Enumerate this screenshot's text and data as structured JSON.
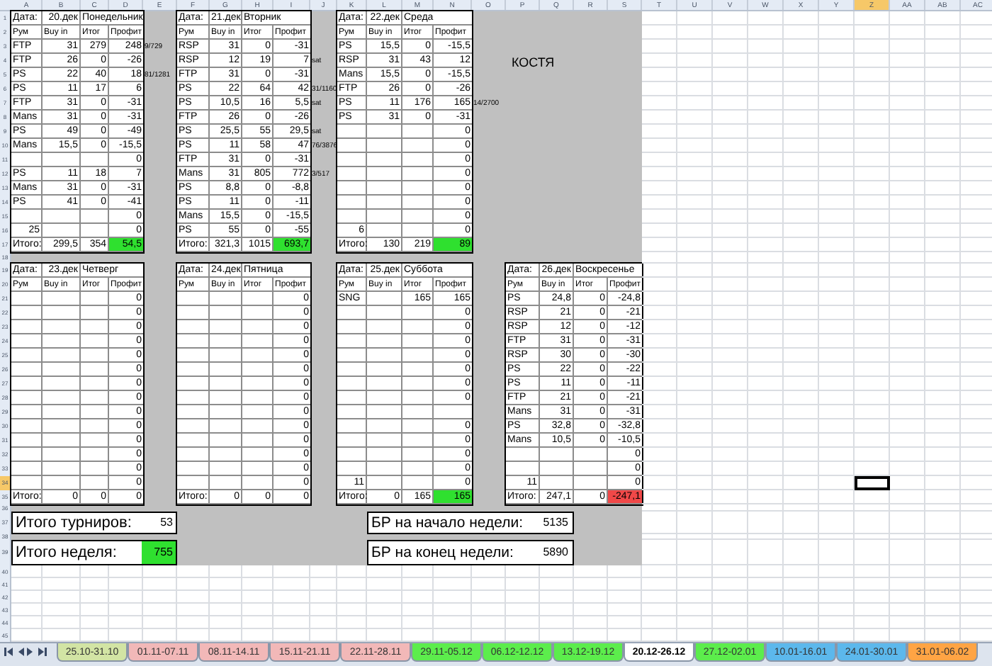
{
  "column_headers": [
    {
      "label": "A",
      "selected": false
    },
    {
      "label": "B",
      "selected": false
    },
    {
      "label": "C",
      "selected": false
    },
    {
      "label": "D",
      "selected": false
    },
    {
      "label": "E",
      "selected": false
    },
    {
      "label": "F",
      "selected": false
    },
    {
      "label": "G",
      "selected": false
    },
    {
      "label": "H",
      "selected": false
    },
    {
      "label": "I",
      "selected": false
    },
    {
      "label": "J",
      "selected": false
    },
    {
      "label": "K",
      "selected": false
    },
    {
      "label": "L",
      "selected": false
    },
    {
      "label": "M",
      "selected": false
    },
    {
      "label": "N",
      "selected": false
    },
    {
      "label": "O",
      "selected": false
    },
    {
      "label": "P",
      "selected": false
    },
    {
      "label": "Q",
      "selected": false
    },
    {
      "label": "R",
      "selected": false
    },
    {
      "label": "S",
      "selected": false
    },
    {
      "label": "T",
      "selected": false
    },
    {
      "label": "U",
      "selected": false
    },
    {
      "label": "V",
      "selected": false
    },
    {
      "label": "W",
      "selected": false
    },
    {
      "label": "X",
      "selected": false
    },
    {
      "label": "Y",
      "selected": false
    },
    {
      "label": "Z",
      "selected": true
    },
    {
      "label": "AA",
      "selected": false
    },
    {
      "label": "AB",
      "selected": false
    },
    {
      "label": "AC",
      "selected": false
    }
  ],
  "row_headers": [
    {
      "label": "1",
      "selected": false
    },
    {
      "label": "2",
      "selected": false
    },
    {
      "label": "3",
      "selected": false
    },
    {
      "label": "4",
      "selected": false
    },
    {
      "label": "5",
      "selected": false
    },
    {
      "label": "6",
      "selected": false
    },
    {
      "label": "7",
      "selected": false
    },
    {
      "label": "8",
      "selected": false
    },
    {
      "label": "9",
      "selected": false
    },
    {
      "label": "10",
      "selected": false
    },
    {
      "label": "11",
      "selected": false
    },
    {
      "label": "12",
      "selected": false
    },
    {
      "label": "13",
      "selected": false
    },
    {
      "label": "14",
      "selected": false
    },
    {
      "label": "15",
      "selected": false
    },
    {
      "label": "16",
      "selected": false
    },
    {
      "label": "17",
      "selected": false
    },
    {
      "label": "18",
      "selected": false
    },
    {
      "label": "19",
      "selected": false
    },
    {
      "label": "20",
      "selected": false
    },
    {
      "label": "21",
      "selected": false
    },
    {
      "label": "22",
      "selected": false
    },
    {
      "label": "23",
      "selected": false
    },
    {
      "label": "24",
      "selected": false
    },
    {
      "label": "25",
      "selected": false
    },
    {
      "label": "26",
      "selected": false
    },
    {
      "label": "27",
      "selected": false
    },
    {
      "label": "28",
      "selected": false
    },
    {
      "label": "29",
      "selected": false
    },
    {
      "label": "30",
      "selected": false
    },
    {
      "label": "31",
      "selected": false
    },
    {
      "label": "32",
      "selected": false
    },
    {
      "label": "33",
      "selected": false
    },
    {
      "label": "34",
      "selected": true
    },
    {
      "label": "35",
      "selected": false
    },
    {
      "label": "36",
      "selected": false
    },
    {
      "label": "37",
      "selected": false
    },
    {
      "label": "38",
      "selected": false
    },
    {
      "label": "39",
      "selected": false
    },
    {
      "label": "40",
      "selected": false
    },
    {
      "label": "41",
      "selected": false
    },
    {
      "label": "42",
      "selected": false
    },
    {
      "label": "43",
      "selected": false
    },
    {
      "label": "44",
      "selected": false
    },
    {
      "label": "45",
      "selected": false
    }
  ],
  "player_name": "КОСТЯ",
  "days": [
    {
      "date_label": "Дата:",
      "date": "20.дек",
      "weekday": "Понедельник",
      "headers": [
        "Рум",
        "Buy in",
        "Итог",
        "Профит"
      ],
      "rows": [
        {
          "room": "FTP",
          "buy_in": "31",
          "result": "279",
          "profit": "248",
          "note": "9/729"
        },
        {
          "room": "FTP",
          "buy_in": "26",
          "result": "0",
          "profit": "-26"
        },
        {
          "room": "PS",
          "buy_in": "22",
          "result": "40",
          "profit": "18",
          "note": "81/1281"
        },
        {
          "room": "PS",
          "buy_in": "11",
          "result": "17",
          "profit": "6"
        },
        {
          "room": "FTP",
          "buy_in": "31",
          "result": "0",
          "profit": "-31"
        },
        {
          "room": "Mans",
          "buy_in": "31",
          "result": "0",
          "profit": "-31"
        },
        {
          "room": "PS",
          "buy_in": "49",
          "result": "0",
          "profit": "-49"
        },
        {
          "room": "Mans",
          "buy_in": "15,5",
          "result": "0",
          "profit": "-15,5"
        },
        {
          "profit": "0"
        },
        {
          "room": "PS",
          "buy_in": "11",
          "result": "18",
          "profit": "7"
        },
        {
          "room": "Mans",
          "buy_in": "31",
          "result": "0",
          "profit": "-31"
        },
        {
          "room": "PS",
          "buy_in": "41",
          "result": "0",
          "profit": "-41"
        },
        {
          "profit": "0"
        },
        {
          "count": "25",
          "profit": "0"
        }
      ],
      "total": {
        "label": "Итого:",
        "buy_in": "299,5",
        "result": "354",
        "profit": "54,5"
      },
      "color": "#2fe02f"
    },
    {
      "date_label": "Дата:",
      "date": "21.дек",
      "weekday": "Вторник",
      "headers": [
        "Рум",
        "Buy in",
        "Итог",
        "Профит"
      ],
      "rows": [
        {
          "room": "RSP",
          "buy_in": "31",
          "result": "0",
          "profit": "-31"
        },
        {
          "room": "RSP",
          "buy_in": "12",
          "result": "19",
          "profit": "7",
          "note": "sat"
        },
        {
          "room": "FTP",
          "buy_in": "31",
          "result": "0",
          "profit": "-31"
        },
        {
          "room": "PS",
          "buy_in": "22",
          "result": "64",
          "profit": "42",
          "note": "31/1160"
        },
        {
          "room": "PS",
          "buy_in": "10,5",
          "result": "16",
          "profit": "5,5",
          "note": "sat"
        },
        {
          "room": "FTP",
          "buy_in": "26",
          "result": "0",
          "profit": "-26"
        },
        {
          "room": "PS",
          "buy_in": "25,5",
          "result": "55",
          "profit": "29,5",
          "note": "sat"
        },
        {
          "room": "PS",
          "buy_in": "11",
          "result": "58",
          "profit": "47",
          "note": "76/3876"
        },
        {
          "room": "FTP",
          "buy_in": "31",
          "result": "0",
          "profit": "-31"
        },
        {
          "room": "Mans",
          "buy_in": "31",
          "result": "805",
          "profit": "772",
          "note": "3/517"
        },
        {
          "room": "PS",
          "buy_in": "8,8",
          "result": "0",
          "profit": "-8,8"
        },
        {
          "room": "PS",
          "buy_in": "11",
          "result": "0",
          "profit": "-11"
        },
        {
          "room": "Mans",
          "buy_in": "15,5",
          "result": "0",
          "profit": "-15,5"
        },
        {
          "room": "PS",
          "buy_in": "55",
          "result": "0",
          "profit": "-55"
        }
      ],
      "total": {
        "label": "Итого:",
        "buy_in": "321,3",
        "result": "1015",
        "profit": "693,7"
      },
      "color": "#2fe02f"
    },
    {
      "date_label": "Дата:",
      "date": "22.дек",
      "weekday": "Среда",
      "headers": [
        "Рум",
        "Buy in",
        "Итог",
        "Профит"
      ],
      "rows": [
        {
          "room": "PS",
          "buy_in": "15,5",
          "result": "0",
          "profit": "-15,5"
        },
        {
          "room": "RSP",
          "buy_in": "31",
          "result": "43",
          "profit": "12"
        },
        {
          "room": "Mans",
          "buy_in": "15,5",
          "result": "0",
          "profit": "-15,5"
        },
        {
          "room": "FTP",
          "buy_in": "26",
          "result": "0",
          "profit": "-26"
        },
        {
          "room": "PS",
          "buy_in": "11",
          "result": "176",
          "profit": "165",
          "note": "14/2700"
        },
        {
          "room": "PS",
          "buy_in": "31",
          "result": "0",
          "profit": "-31"
        },
        {
          "profit": "0"
        },
        {
          "profit": "0"
        },
        {
          "profit": "0"
        },
        {
          "profit": "0"
        },
        {
          "profit": "0"
        },
        {
          "profit": "0"
        },
        {
          "profit": "0"
        },
        {
          "count": "6",
          "profit": "0"
        }
      ],
      "total": {
        "label": "Итого:",
        "buy_in": "130",
        "result": "219",
        "profit": "89"
      },
      "color": "#2fe02f"
    },
    {
      "date_label": "Дата:",
      "date": "23.дек",
      "weekday": "Четверг",
      "headers": [
        "Рум",
        "Buy in",
        "Итог",
        "Профит"
      ],
      "rows": [
        {
          "profit": "0"
        },
        {
          "profit": "0"
        },
        {
          "profit": "0"
        },
        {
          "profit": "0"
        },
        {
          "profit": "0"
        },
        {
          "profit": "0"
        },
        {
          "profit": "0"
        },
        {
          "profit": "0"
        },
        {
          "profit": "0"
        },
        {
          "profit": "0"
        },
        {
          "profit": "0"
        },
        {
          "profit": "0"
        },
        {
          "profit": "0"
        },
        {
          "profit": "0"
        }
      ],
      "total": {
        "label": "Итого:",
        "buy_in": "0",
        "result": "0",
        "profit": "0"
      }
    },
    {
      "date_label": "Дата:",
      "date": "24.дек",
      "weekday": "Пятница",
      "headers": [
        "Рум",
        "Buy in",
        "Итог",
        "Профит"
      ],
      "rows": [
        {
          "profit": "0"
        },
        {
          "profit": "0"
        },
        {
          "profit": "0"
        },
        {
          "profit": "0"
        },
        {
          "profit": "0"
        },
        {
          "profit": "0"
        },
        {
          "profit": "0"
        },
        {
          "profit": "0"
        },
        {
          "profit": "0"
        },
        {
          "profit": "0"
        },
        {
          "profit": "0"
        },
        {
          "profit": "0"
        },
        {
          "profit": "0"
        },
        {
          "profit": "0"
        }
      ],
      "total": {
        "label": "Итого:",
        "buy_in": "0",
        "result": "0",
        "profit": "0"
      }
    },
    {
      "date_label": "Дата:",
      "date": "25.дек",
      "weekday": "Суббота",
      "headers": [
        "Рум",
        "Buy in",
        "Итог",
        "Профит"
      ],
      "rows": [
        {
          "room": "SNG",
          "result": "165",
          "profit": "165"
        },
        {
          "profit": "0"
        },
        {
          "profit": "0"
        },
        {
          "profit": "0"
        },
        {
          "profit": "0"
        },
        {
          "profit": "0"
        },
        {
          "profit": "0"
        },
        {
          "profit": "0"
        },
        {},
        {
          "profit": "0"
        },
        {
          "profit": "0"
        },
        {
          "profit": "0"
        },
        {
          "profit": "0"
        },
        {
          "count": "11",
          "profit": "0"
        }
      ],
      "total": {
        "label": "Итого:",
        "buy_in": "0",
        "result": "165",
        "profit": "165"
      },
      "color": "#2fe02f"
    },
    {
      "date_label": "Дата:",
      "date": "26.дек",
      "weekday": "Воскресенье",
      "headers": [
        "Рум",
        "Buy in",
        "Итог",
        "Профит"
      ],
      "rows": [
        {
          "room": "PS",
          "buy_in": "24,8",
          "result": "0",
          "profit": "-24,8"
        },
        {
          "room": "RSP",
          "buy_in": "21",
          "result": "0",
          "profit": "-21"
        },
        {
          "room": "RSP",
          "buy_in": "12",
          "result": "0",
          "profit": "-12"
        },
        {
          "room": "FTP",
          "buy_in": "31",
          "result": "0",
          "profit": "-31"
        },
        {
          "room": "RSP",
          "buy_in": "30",
          "result": "0",
          "profit": "-30"
        },
        {
          "room": "PS",
          "buy_in": "22",
          "result": "0",
          "profit": "-22"
        },
        {
          "room": "PS",
          "buy_in": "11",
          "result": "0",
          "profit": "-11"
        },
        {
          "room": "FTP",
          "buy_in": "21",
          "result": "0",
          "profit": "-21"
        },
        {
          "room": "Mans",
          "buy_in": "31",
          "result": "0",
          "profit": "-31"
        },
        {
          "room": "PS",
          "buy_in": "32,8",
          "result": "0",
          "profit": "-32,8"
        },
        {
          "room": "Mans",
          "buy_in": "10,5",
          "result": "0",
          "profit": "-10,5"
        },
        {
          "profit": "0"
        },
        {
          "profit": "0"
        },
        {
          "count": "11",
          "profit": "0"
        }
      ],
      "total": {
        "label": "Итого:",
        "buy_in": "247,1",
        "result": "0",
        "profit": "-247,1"
      },
      "color": "#f04848"
    }
  ],
  "summary": [
    {
      "label": "Итого турниров:",
      "value": "53",
      "highlight": false
    },
    {
      "label": "Итого неделя:",
      "value": "755",
      "highlight": true
    }
  ],
  "bankroll": [
    {
      "label": "БР на начало недели:",
      "value": "5135"
    },
    {
      "label": "БР на конец недели:",
      "value": "5890"
    }
  ],
  "sheet_tabs": [
    {
      "label": "25.10-31.10",
      "color": "#d2e4a4",
      "selected": false
    },
    {
      "label": "01.11-07.11",
      "color": "#f2b8b8",
      "selected": false
    },
    {
      "label": "08.11-14.11",
      "color": "#f2b8b8",
      "selected": false
    },
    {
      "label": "15.11-21.11",
      "color": "#f2b8b8",
      "selected": false
    },
    {
      "label": "22.11-28.11",
      "color": "#f2b8b8",
      "selected": false
    },
    {
      "label": "29.11-05.12",
      "color": "#5ced4c",
      "selected": false
    },
    {
      "label": "06.12-12.12",
      "color": "#5ced4c",
      "selected": false
    },
    {
      "label": "13.12-19.12",
      "color": "#5ced4c",
      "selected": false
    },
    {
      "label": "20.12-26.12",
      "selected": true
    },
    {
      "label": "27.12-02.01",
      "color": "#5ced4c",
      "selected": false
    },
    {
      "label": "10.01-16.01",
      "color": "#5cb8ec",
      "selected": false
    },
    {
      "label": "24.01-30.01",
      "color": "#5cb8ec",
      "selected": false
    },
    {
      "label": "31.01-06.02",
      "color": "#ffa444",
      "selected": false
    }
  ]
}
